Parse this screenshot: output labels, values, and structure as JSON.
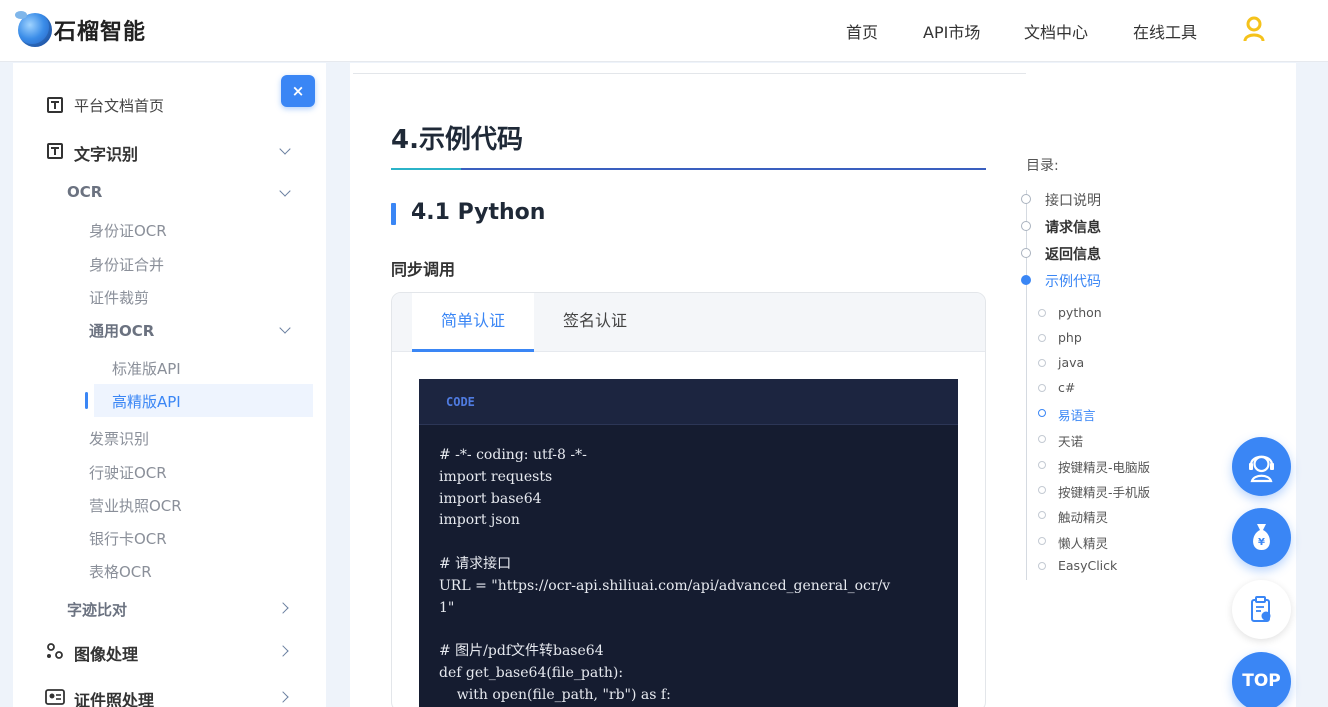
{
  "brand": {
    "name": "石榴智能"
  },
  "nav": {
    "items": [
      "首页",
      "API市场",
      "文档中心",
      "在线工具"
    ]
  },
  "sidebar": {
    "close_label": "×",
    "platform_home": "平台文档首页",
    "text_recognition": "文字识别",
    "ocr": "OCR",
    "ocr_items": [
      "身份证OCR",
      "身份证合并",
      "证件裁剪"
    ],
    "general_ocr": "通用OCR",
    "general_items": [
      "标准版API",
      "高精版API"
    ],
    "more_items": [
      "发票识别",
      "行驶证OCR",
      "营业执照OCR",
      "银行卡OCR",
      "表格OCR"
    ],
    "handwriting": "字迹比对",
    "image_processing": "图像处理",
    "id_photo": "证件照处理"
  },
  "content": {
    "h1": "4.示例代码",
    "h2": "4.1 Python",
    "h3": "同步调用",
    "tabs": [
      "简单认证",
      "签名认证"
    ],
    "code_label": "CODE",
    "code": "# -*- coding: utf-8 -*-\nimport requests\nimport base64\nimport json\n\n# 请求接口\nURL = \"https://ocr-api.shiliuai.com/api/advanced_general_ocr/v\n1\"\n\n# 图片/pdf文件转base64\ndef get_base64(file_path):\n    with open(file_path, \"rb\") as f:"
  },
  "toc": {
    "title": "目录:",
    "items": [
      "接口说明",
      "请求信息",
      "返回信息",
      "示例代码"
    ],
    "subs": [
      "python",
      "php",
      "java",
      "c#",
      "易语言",
      "天诺",
      "按键精灵-电脑版",
      "按键精灵-手机版",
      "触动精灵",
      "懒人精灵",
      "EasyClick"
    ]
  },
  "floating": {
    "top_label": "TOP"
  },
  "colors": {
    "accent": "#3a86f5",
    "code_bg": "#151c30"
  }
}
